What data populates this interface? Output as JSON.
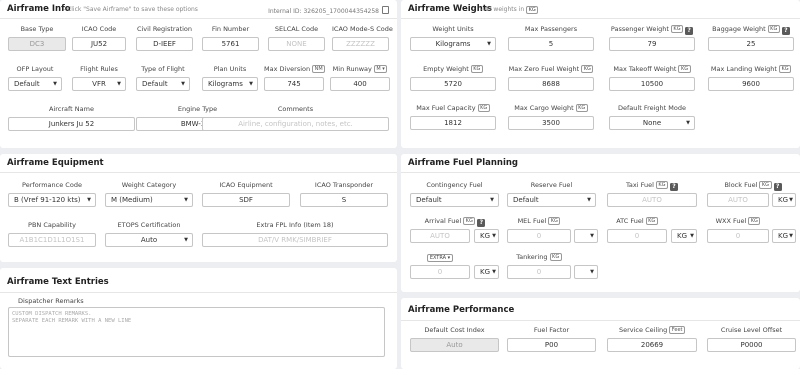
{
  "info": {
    "title": "Airframe Info",
    "hint": "- Click \"Save Airframe\" to save these options",
    "internal_id": "Internal ID: 326205_1700044354258",
    "base_type": {
      "label": "Base Type",
      "value": "DC3"
    },
    "icao_code": {
      "label": "ICAO Code",
      "value": "JU52"
    },
    "civil_reg": {
      "label": "Civil Registration",
      "value": "D-IEEF"
    },
    "fin_number": {
      "label": "Fin Number",
      "value": "5761"
    },
    "selcal": {
      "label": "SELCAL Code",
      "placeholder": "NONE"
    },
    "mode_s": {
      "label": "ICAO Mode-S Code",
      "placeholder": "ZZZZZZ"
    },
    "ofp_layout": {
      "label": "OFP Layout",
      "value": "Default"
    },
    "flight_rules": {
      "label": "Flight Rules",
      "value": "VFR"
    },
    "type_of_flight": {
      "label": "Type of Flight",
      "value": "Default"
    },
    "plan_units": {
      "label": "Plan Units",
      "value": "Kilograms"
    },
    "max_diversion": {
      "label": "Max Diversion",
      "unit": "NM",
      "value": "745"
    },
    "min_runway": {
      "label": "Min Runway",
      "unit": "M",
      "value": "400"
    },
    "aircraft_name": {
      "label": "Aircraft Name",
      "value": "Junkers Ju 52"
    },
    "engine_type": {
      "label": "Engine Type",
      "value": "BMW-321"
    },
    "comments": {
      "label": "Comments",
      "placeholder": "Airline, configuration, notes, etc."
    }
  },
  "weights": {
    "title": "Airframe Weights",
    "sub": "- All weights in",
    "sub_unit": "KG",
    "weight_units": {
      "label": "Weight Units",
      "value": "Kilograms"
    },
    "max_passengers": {
      "label": "Max Passengers",
      "value": "5"
    },
    "passenger_weight": {
      "label": "Passenger Weight",
      "unit": "KG",
      "value": "79"
    },
    "baggage_weight": {
      "label": "Baggage Weight",
      "unit": "KG",
      "value": "25"
    },
    "empty_weight": {
      "label": "Empty Weight",
      "unit": "KG",
      "value": "5720"
    },
    "mzfw": {
      "label": "Max Zero Fuel Weight",
      "unit": "KG",
      "value": "8688"
    },
    "mtow": {
      "label": "Max Takeoff Weight",
      "unit": "KG",
      "value": "10500"
    },
    "mlw": {
      "label": "Max Landing Weight",
      "unit": "KG",
      "value": "9600"
    },
    "max_fuel": {
      "label": "Max Fuel Capacity",
      "unit": "KG",
      "value": "1812"
    },
    "max_cargo": {
      "label": "Max Cargo Weight",
      "unit": "KG",
      "value": "3500"
    },
    "freight_mode": {
      "label": "Default Freight Mode",
      "value": "None"
    }
  },
  "equipment": {
    "title": "Airframe Equipment",
    "perf_code": {
      "label": "Performance Code",
      "value": "B (Vref 91-120 kts)"
    },
    "weight_cat": {
      "label": "Weight Category",
      "value": "M (Medium)"
    },
    "icao_equip": {
      "label": "ICAO Equipment",
      "value": "SDF"
    },
    "icao_transponder": {
      "label": "ICAO Transponder",
      "value": "S"
    },
    "pbn": {
      "label": "PBN Capability",
      "placeholder": "A1B1C1D1L1O1S1"
    },
    "etops": {
      "label": "ETOPS Certification",
      "value": "Auto"
    },
    "extra_fpl": {
      "label": "Extra FPL Info (Item 18)",
      "placeholder": "DAT/V RMK/SIMBRIEF"
    }
  },
  "fuel": {
    "title": "Airframe Fuel Planning",
    "contingency": {
      "label": "Contingency Fuel",
      "value": "Default"
    },
    "reserve": {
      "label": "Reserve Fuel",
      "value": "Default"
    },
    "taxi": {
      "label": "Taxi Fuel",
      "unit": "KG",
      "placeholder": "AUTO"
    },
    "block": {
      "label": "Block Fuel",
      "unit": "KG",
      "placeholder": "AUTO",
      "unit_select": "KG"
    },
    "arrival": {
      "label": "Arrival Fuel",
      "unit": "KG",
      "placeholder": "AUTO",
      "unit_select": "KG"
    },
    "mel": {
      "label": "MEL Fuel",
      "unit": "KG",
      "placeholder": "0"
    },
    "atc": {
      "label": "ATC Fuel",
      "unit": "KG",
      "placeholder": "0",
      "unit_select": "KG"
    },
    "wxx": {
      "label": "WXX Fuel",
      "unit": "KG",
      "placeholder": "0",
      "unit_select": "KG"
    },
    "extra": {
      "label": "EXTRA",
      "placeholder": "0",
      "unit_select": "KG"
    },
    "tankering": {
      "label": "Tankering",
      "unit": "KG",
      "placeholder": "0"
    }
  },
  "text_entries": {
    "title": "Airframe Text Entries",
    "remarks_label": "Dispatcher Remarks",
    "remarks_placeholder": "CUSTOM DISPATCH REMARKS.\nSEPARATE EACH REMARK WITH A NEW LINE"
  },
  "performance": {
    "title": "Airframe Performance",
    "cost_index": {
      "label": "Default Cost Index",
      "value": "Auto"
    },
    "fuel_factor": {
      "label": "Fuel Factor",
      "value": "P00"
    },
    "ceiling": {
      "label": "Service Ceiling",
      "unit": "Feet",
      "value": "20669"
    },
    "cruise_offset": {
      "label": "Cruise Level Offset",
      "value": "P0000"
    }
  }
}
